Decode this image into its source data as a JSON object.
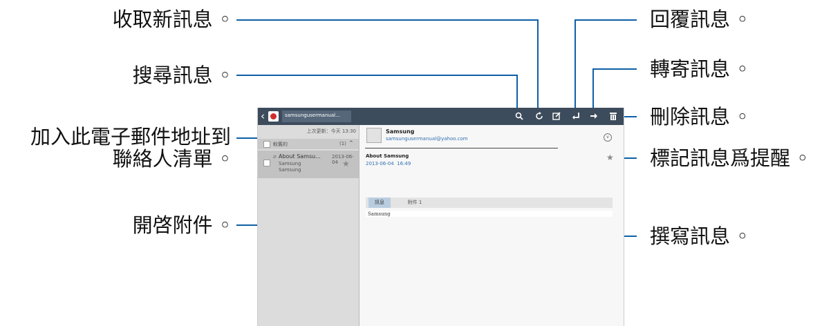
{
  "callouts": {
    "fetch": "收取新訊息 ◦",
    "search": "搜尋訊息 ◦",
    "add_contact_line1": "加入此電子郵件地址到",
    "add_contact_line2": "聯絡人清單 ◦",
    "open_attachment": "開啓附件 ◦",
    "reply": "回覆訊息 ◦",
    "forward": "轉寄訊息 ◦",
    "delete": "刪除訊息 ◦",
    "flag": "標記訊息爲提醒 ◦",
    "compose": "撰寫訊息 ◦"
  },
  "toolbar": {
    "account": "samsungusermanual..."
  },
  "left_panel": {
    "last_updated": "上次更新：今天 13:30",
    "folder_name": "較舊的",
    "folder_count": "(1)",
    "message": {
      "subject": "About Samsu...",
      "date": "2013-06-04",
      "sender": "Samsung",
      "preview": "Samsung"
    }
  },
  "message": {
    "sender_name": "Samsung",
    "sender_email": "samsungusermanual@yahoo.com",
    "subject": "About Samsung",
    "datetime": "2013-06-04  16:49",
    "tab_message": "訊息",
    "tab_attachment": "附件 1",
    "body": "Samsung"
  },
  "colors": {
    "callout_line": "#0d5fa6",
    "toolbar_bg": "#3d4c5c"
  }
}
